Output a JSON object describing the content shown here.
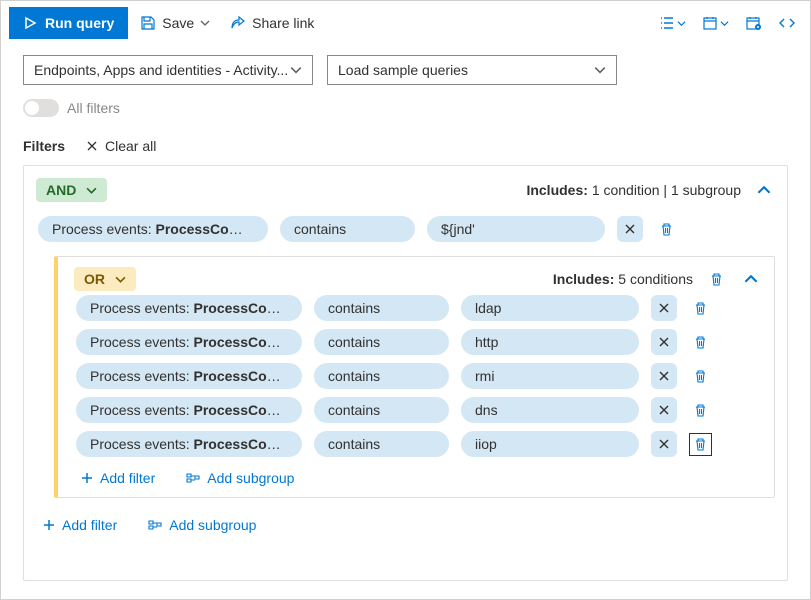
{
  "toolbar": {
    "run_query": "Run query",
    "save": "Save",
    "share": "Share link"
  },
  "dropdowns": {
    "source": "Endpoints, Apps and identities - Activity...",
    "samples": "Load sample queries"
  },
  "all_filters_label": "All filters",
  "filters": {
    "title": "Filters",
    "clear_all": "Clear all",
    "add_filter": "Add filter",
    "add_subgroup": "Add subgroup"
  },
  "group": {
    "logic": "AND",
    "includes_label": "Includes:",
    "includes_value": "1 condition | 1 subgroup",
    "condition": {
      "field_prefix": "Process events: ",
      "field_bold": "ProcessComman...",
      "operator": "contains",
      "value": "${jnd'"
    }
  },
  "subgroup": {
    "logic": "OR",
    "includes_label": "Includes:",
    "includes_value": "5 conditions",
    "conditions": [
      {
        "field_prefix": "Process events: ",
        "field_bold": "ProcessComman...",
        "operator": "contains",
        "value": "ldap"
      },
      {
        "field_prefix": "Process events: ",
        "field_bold": "ProcessComman...",
        "operator": "contains",
        "value": "http"
      },
      {
        "field_prefix": "Process events: ",
        "field_bold": "ProcessComman...",
        "operator": "contains",
        "value": "rmi"
      },
      {
        "field_prefix": "Process events: ",
        "field_bold": "ProcessComman...",
        "operator": "contains",
        "value": "dns"
      },
      {
        "field_prefix": "Process events: ",
        "field_bold": "ProcessComman...",
        "operator": "contains",
        "value": "iiop"
      }
    ]
  }
}
